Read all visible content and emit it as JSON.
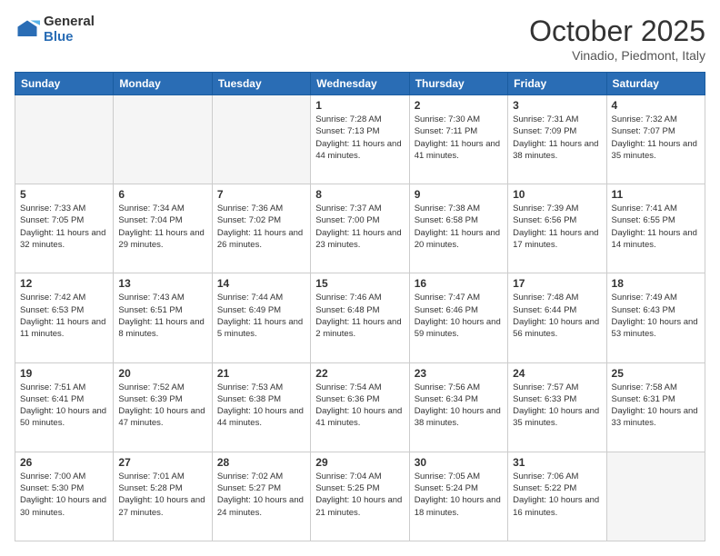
{
  "logo": {
    "general": "General",
    "blue": "Blue"
  },
  "header": {
    "month": "October 2025",
    "location": "Vinadio, Piedmont, Italy"
  },
  "days_of_week": [
    "Sunday",
    "Monday",
    "Tuesday",
    "Wednesday",
    "Thursday",
    "Friday",
    "Saturday"
  ],
  "weeks": [
    [
      {
        "day": "",
        "empty": true
      },
      {
        "day": "",
        "empty": true
      },
      {
        "day": "",
        "empty": true
      },
      {
        "day": "1",
        "sunrise": "7:28 AM",
        "sunset": "7:13 PM",
        "daylight": "11 hours and 44 minutes."
      },
      {
        "day": "2",
        "sunrise": "7:30 AM",
        "sunset": "7:11 PM",
        "daylight": "11 hours and 41 minutes."
      },
      {
        "day": "3",
        "sunrise": "7:31 AM",
        "sunset": "7:09 PM",
        "daylight": "11 hours and 38 minutes."
      },
      {
        "day": "4",
        "sunrise": "7:32 AM",
        "sunset": "7:07 PM",
        "daylight": "11 hours and 35 minutes."
      }
    ],
    [
      {
        "day": "5",
        "sunrise": "7:33 AM",
        "sunset": "7:05 PM",
        "daylight": "11 hours and 32 minutes."
      },
      {
        "day": "6",
        "sunrise": "7:34 AM",
        "sunset": "7:04 PM",
        "daylight": "11 hours and 29 minutes."
      },
      {
        "day": "7",
        "sunrise": "7:36 AM",
        "sunset": "7:02 PM",
        "daylight": "11 hours and 26 minutes."
      },
      {
        "day": "8",
        "sunrise": "7:37 AM",
        "sunset": "7:00 PM",
        "daylight": "11 hours and 23 minutes."
      },
      {
        "day": "9",
        "sunrise": "7:38 AM",
        "sunset": "6:58 PM",
        "daylight": "11 hours and 20 minutes."
      },
      {
        "day": "10",
        "sunrise": "7:39 AM",
        "sunset": "6:56 PM",
        "daylight": "11 hours and 17 minutes."
      },
      {
        "day": "11",
        "sunrise": "7:41 AM",
        "sunset": "6:55 PM",
        "daylight": "11 hours and 14 minutes."
      }
    ],
    [
      {
        "day": "12",
        "sunrise": "7:42 AM",
        "sunset": "6:53 PM",
        "daylight": "11 hours and 11 minutes."
      },
      {
        "day": "13",
        "sunrise": "7:43 AM",
        "sunset": "6:51 PM",
        "daylight": "11 hours and 8 minutes."
      },
      {
        "day": "14",
        "sunrise": "7:44 AM",
        "sunset": "6:49 PM",
        "daylight": "11 hours and 5 minutes."
      },
      {
        "day": "15",
        "sunrise": "7:46 AM",
        "sunset": "6:48 PM",
        "daylight": "11 hours and 2 minutes."
      },
      {
        "day": "16",
        "sunrise": "7:47 AM",
        "sunset": "6:46 PM",
        "daylight": "10 hours and 59 minutes."
      },
      {
        "day": "17",
        "sunrise": "7:48 AM",
        "sunset": "6:44 PM",
        "daylight": "10 hours and 56 minutes."
      },
      {
        "day": "18",
        "sunrise": "7:49 AM",
        "sunset": "6:43 PM",
        "daylight": "10 hours and 53 minutes."
      }
    ],
    [
      {
        "day": "19",
        "sunrise": "7:51 AM",
        "sunset": "6:41 PM",
        "daylight": "10 hours and 50 minutes."
      },
      {
        "day": "20",
        "sunrise": "7:52 AM",
        "sunset": "6:39 PM",
        "daylight": "10 hours and 47 minutes."
      },
      {
        "day": "21",
        "sunrise": "7:53 AM",
        "sunset": "6:38 PM",
        "daylight": "10 hours and 44 minutes."
      },
      {
        "day": "22",
        "sunrise": "7:54 AM",
        "sunset": "6:36 PM",
        "daylight": "10 hours and 41 minutes."
      },
      {
        "day": "23",
        "sunrise": "7:56 AM",
        "sunset": "6:34 PM",
        "daylight": "10 hours and 38 minutes."
      },
      {
        "day": "24",
        "sunrise": "7:57 AM",
        "sunset": "6:33 PM",
        "daylight": "10 hours and 35 minutes."
      },
      {
        "day": "25",
        "sunrise": "7:58 AM",
        "sunset": "6:31 PM",
        "daylight": "10 hours and 33 minutes."
      }
    ],
    [
      {
        "day": "26",
        "sunrise": "7:00 AM",
        "sunset": "5:30 PM",
        "daylight": "10 hours and 30 minutes."
      },
      {
        "day": "27",
        "sunrise": "7:01 AM",
        "sunset": "5:28 PM",
        "daylight": "10 hours and 27 minutes."
      },
      {
        "day": "28",
        "sunrise": "7:02 AM",
        "sunset": "5:27 PM",
        "daylight": "10 hours and 24 minutes."
      },
      {
        "day": "29",
        "sunrise": "7:04 AM",
        "sunset": "5:25 PM",
        "daylight": "10 hours and 21 minutes."
      },
      {
        "day": "30",
        "sunrise": "7:05 AM",
        "sunset": "5:24 PM",
        "daylight": "10 hours and 18 minutes."
      },
      {
        "day": "31",
        "sunrise": "7:06 AM",
        "sunset": "5:22 PM",
        "daylight": "10 hours and 16 minutes."
      },
      {
        "day": "",
        "empty": true
      }
    ]
  ]
}
